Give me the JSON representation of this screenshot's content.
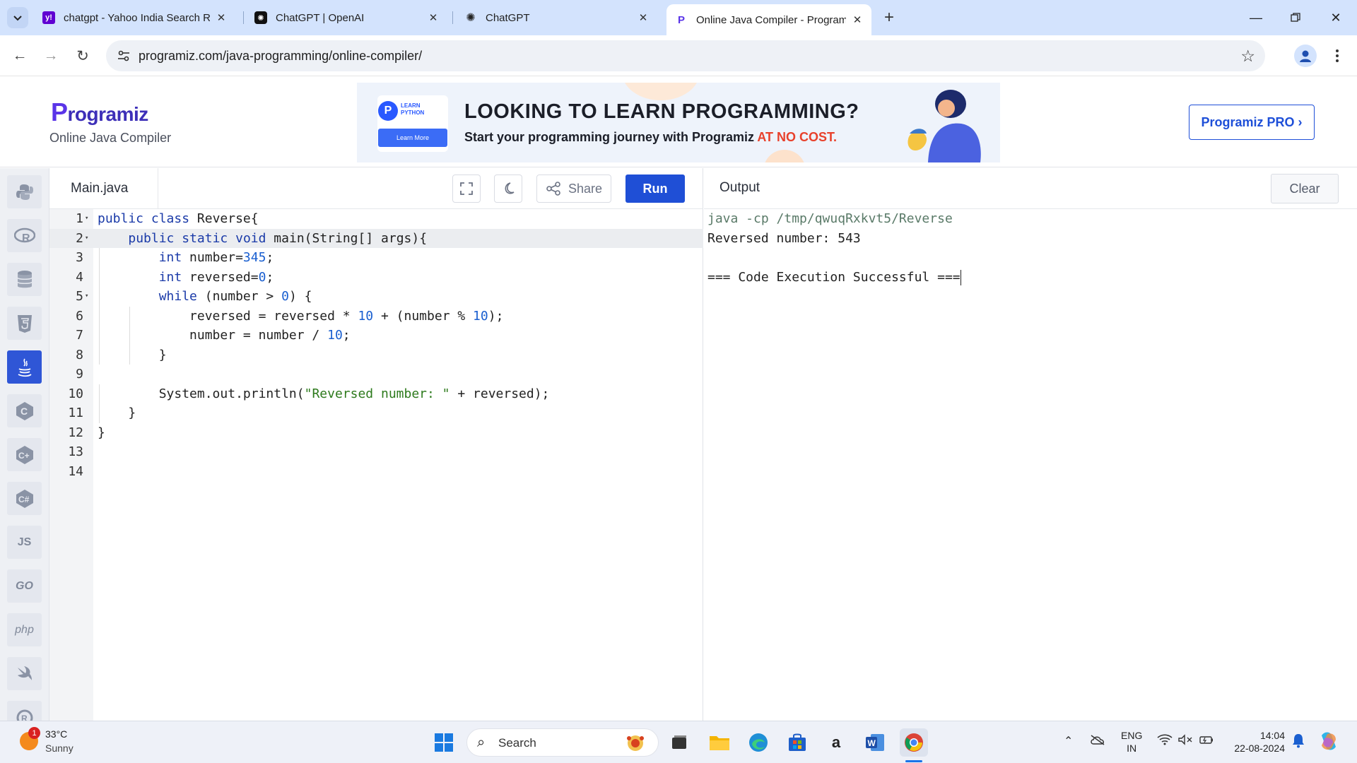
{
  "browser": {
    "tabs": [
      {
        "title": "chatgpt - Yahoo India Search Re",
        "icon": "yahoo-icon"
      },
      {
        "title": "ChatGPT | OpenAI",
        "icon": "openai-icon"
      },
      {
        "title": "ChatGPT",
        "icon": "openai-icon"
      },
      {
        "title": "Online Java Compiler - Program",
        "icon": "programiz-icon",
        "active": true
      }
    ],
    "url": "programiz.com/java-programming/online-compiler/"
  },
  "site": {
    "logo": "rogramiz",
    "logo_initial": "P",
    "subtitle": "Online Java Compiler",
    "pro_button": "Programiz PRO ›"
  },
  "banner": {
    "learn_tag_line1": "LEARN",
    "learn_tag_line2": "PYTHON",
    "learn_button": "Learn More",
    "headline": "LOOKING TO LEARN PROGRAMMING?",
    "subline": "Start your programming journey with Programiz ",
    "subline_highlight": "AT NO COST."
  },
  "languages": [
    "python",
    "r",
    "sql",
    "html",
    "java",
    "c",
    "cpp",
    "csharp",
    "JS",
    "GO",
    "php",
    "swift",
    "rust"
  ],
  "editor": {
    "filename": "Main.java",
    "share_label": "Share",
    "run_label": "Run",
    "current_line": 2,
    "lines": [
      "public class Reverse{",
      "    public static void main(String[] args){",
      "        int number=345;",
      "        int reversed=0;",
      "        while (number > 0) {",
      "            reversed = reversed * 10 + (number % 10);",
      "            number = number / 10;",
      "        }",
      "",
      "        System.out.println(\"Reversed number: \" + reversed);",
      "    }",
      "}",
      "",
      ""
    ]
  },
  "output": {
    "title": "Output",
    "clear_label": "Clear",
    "command": "java -cp /tmp/qwuqRxkvt5/Reverse",
    "result": "Reversed number: 543",
    "status": "=== Code Execution Successful ==="
  },
  "taskbar": {
    "weather_temp": "33°C",
    "weather_desc": "Sunny",
    "weather_badge": "1",
    "search_placeholder": "Search",
    "lang_line1": "ENG",
    "lang_line2": "IN",
    "time": "14:04",
    "date": "22-08-2024"
  }
}
